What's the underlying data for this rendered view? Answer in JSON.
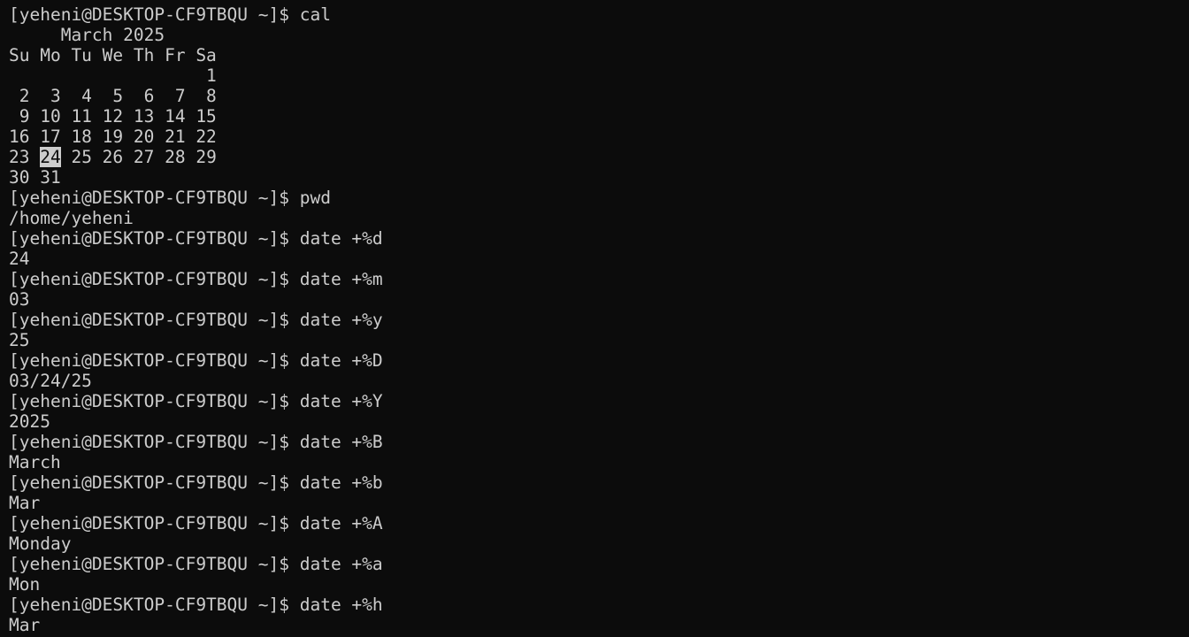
{
  "terminal": {
    "background": "#0c0c0c",
    "foreground": "#cccccc",
    "prompt": "[yeheni@DESKTOP-CF9TBQU ~]$ ",
    "cal": {
      "command": "cal",
      "header": "     March 2025",
      "weekdays": "Su Mo Tu We Th Fr Sa",
      "week1": "                   1",
      "week2": " 2  3  4  5  6  7  8",
      "week3": " 9 10 11 12 13 14 15",
      "week4": "16 17 18 19 20 21 22",
      "week5_before": "23 ",
      "today": "24",
      "week5_after": " 25 26 27 28 29",
      "week6": "30 31"
    },
    "commands": [
      {
        "command": "pwd",
        "output": "/home/yeheni"
      },
      {
        "command": "date +%d",
        "output": "24"
      },
      {
        "command": "date +%m",
        "output": "03"
      },
      {
        "command": "date +%y",
        "output": "25"
      },
      {
        "command": "date +%D",
        "output": "03/24/25"
      },
      {
        "command": "date +%Y",
        "output": "2025"
      },
      {
        "command": "date +%B",
        "output": "March"
      },
      {
        "command": "date +%b",
        "output": "Mar"
      },
      {
        "command": "date +%A",
        "output": "Monday"
      },
      {
        "command": "date +%a",
        "output": "Mon"
      },
      {
        "command": "date +%h",
        "output": "Mar"
      }
    ]
  }
}
